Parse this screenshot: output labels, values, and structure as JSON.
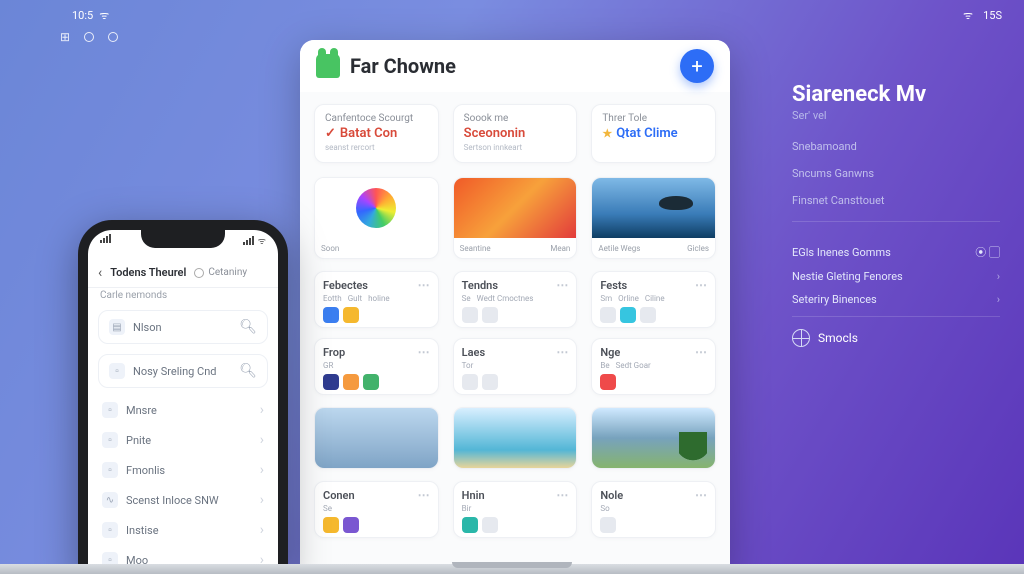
{
  "statusbar": {
    "clock": "10:5",
    "wifi_icon": "wifi",
    "battery": "15S"
  },
  "window": {
    "title": "Far Chowne",
    "add_label": "+",
    "categories": [
      {
        "title": "Canfentoce Scourgt",
        "value": "Batat Con",
        "sub": "seanst rercort",
        "style": "red",
        "prefix_icon": "check"
      },
      {
        "title": "Soook me",
        "value": "Sceononin",
        "sub": "Sertson innkeart",
        "style": "red",
        "prefix_icon": ""
      },
      {
        "title": "Threr Tole",
        "value": "Qtat Clime",
        "sub": "",
        "style": "blue",
        "prefix_icon": "star"
      }
    ],
    "thumbs_a": [
      {
        "kind": "rainbow",
        "cap_l": "Soon",
        "cap_r": ""
      },
      {
        "kind": "poly",
        "cap_l": "Seantine",
        "cap_r": "Mean"
      },
      {
        "kind": "sea",
        "cap_l": "Aetile Wegs",
        "cap_r": "Gicles"
      }
    ],
    "mini_a": [
      {
        "title": "Febectes",
        "sub": [
          "Eotth",
          "Gult",
          "holine"
        ],
        "icons": [
          "blue",
          "yellow"
        ]
      },
      {
        "title": "Tendns",
        "sub": [
          "Se",
          "Wedt Cmoctnes"
        ],
        "icons": [
          "grey",
          "grey"
        ]
      },
      {
        "title": "Fests",
        "sub": [
          "Sm",
          "Orline",
          "Ciline"
        ],
        "icons": [
          "grey",
          "cyan",
          "grey"
        ]
      }
    ],
    "mini_b": [
      {
        "title": "Frop",
        "sub": [
          "GR"
        ],
        "icons": [
          "navy",
          "orange",
          "green"
        ]
      },
      {
        "title": "Laes",
        "sub": [
          "Tor"
        ],
        "icons": [
          "grey",
          "grey"
        ]
      },
      {
        "title": "Nge",
        "sub": [
          "Be",
          "Sedt Goar"
        ],
        "icons": [
          "red"
        ]
      }
    ],
    "thumbs_b": [
      {
        "kind": "city",
        "cap_l": "",
        "cap_r": ""
      },
      {
        "kind": "beach",
        "cap_l": "",
        "cap_r": ""
      },
      {
        "kind": "forest",
        "cap_l": "",
        "cap_r": ""
      }
    ],
    "mini_c": [
      {
        "title": "Conen",
        "sub": [
          "Se"
        ],
        "icons": [
          "yellow",
          "purple"
        ]
      },
      {
        "title": "Hnin",
        "sub": [
          "Bir"
        ],
        "icons": [
          "teal",
          "grey"
        ]
      },
      {
        "title": "Nole",
        "sub": [
          "So"
        ],
        "icons": [
          "grey"
        ]
      }
    ]
  },
  "phone": {
    "status_signal": "ul",
    "header_title": "Todens Theurel",
    "header_action": "Cetaniny",
    "subtitle": "Carle nemonds",
    "rows": [
      {
        "icon": "doc",
        "label": "Nlson",
        "trail": "search"
      },
      {
        "icon": "",
        "label": "Nosy Sreling Cnd",
        "trail": "search"
      },
      {
        "icon": "box",
        "label": "Mnsre",
        "trail": ""
      },
      {
        "icon": "box",
        "label": "Pnite",
        "trail": ""
      },
      {
        "icon": "box",
        "label": "Fmonlis",
        "trail": ""
      },
      {
        "icon": "wave",
        "label": "Scenst Inloce SNW",
        "trail": ""
      },
      {
        "icon": "box",
        "label": "Instise",
        "trail": ""
      },
      {
        "icon": "box",
        "label": "Moo",
        "trail": ""
      }
    ]
  },
  "side": {
    "title": "Siareneck Mv",
    "subtitle": "Ser' vel",
    "links_top": [
      "Snebamoand",
      "Sncums Ganwns",
      "Finsnet Cansttouet"
    ],
    "section_label": "EGls Inenes Gomms",
    "items": [
      {
        "label": "Nestie Gleting Fenores"
      },
      {
        "label": "Seteriry Binences"
      }
    ],
    "footer": "Smocls"
  }
}
